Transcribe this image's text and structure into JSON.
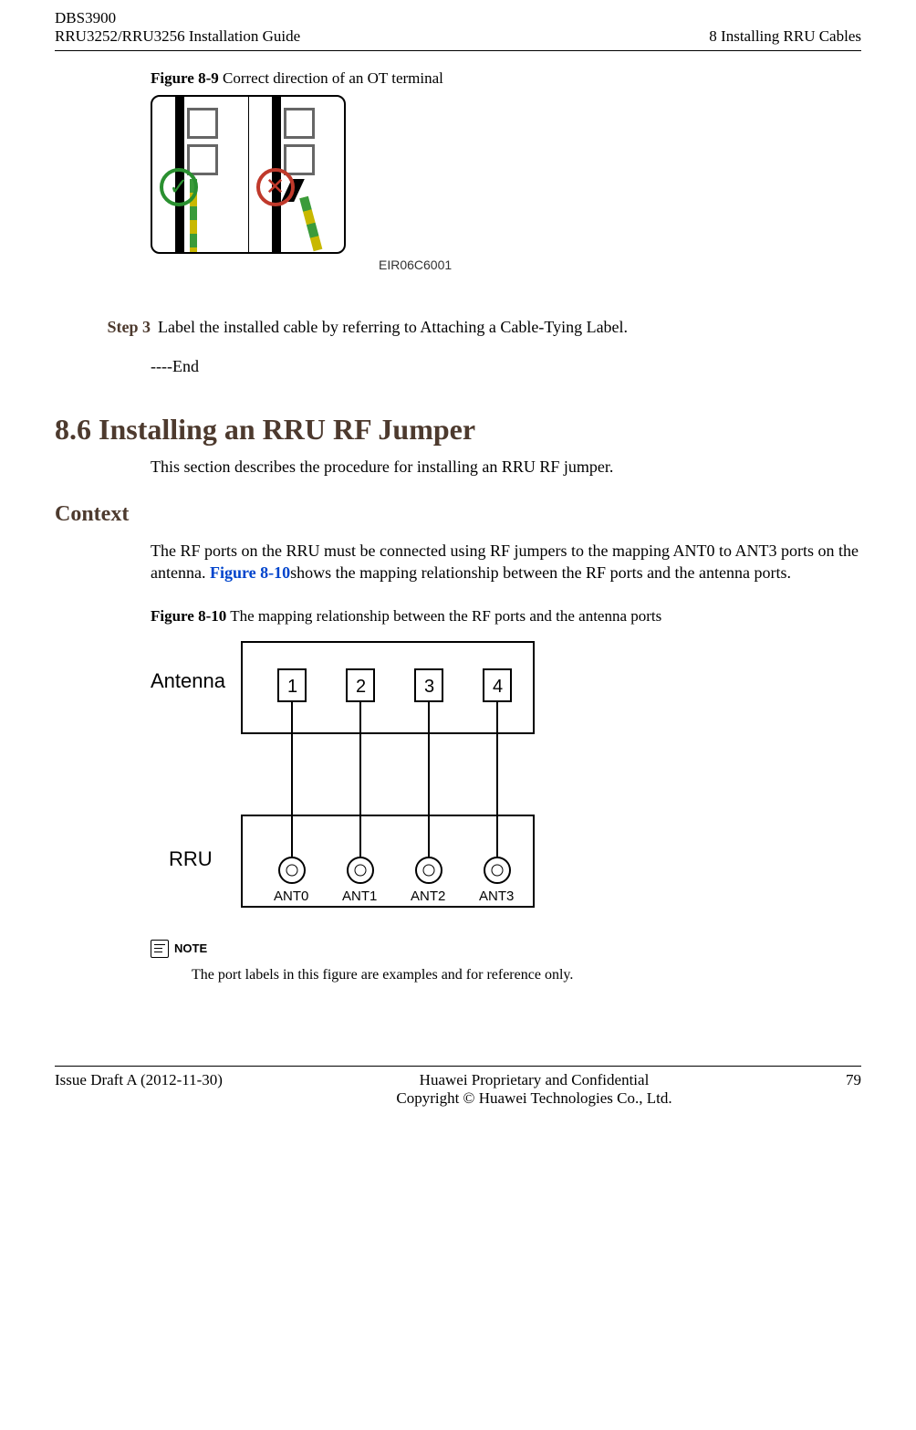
{
  "header": {
    "product": "DBS3900",
    "guide": "RRU3252/RRU3256 Installation Guide",
    "chapter": "8 Installing RRU Cables"
  },
  "figure_8_9": {
    "label": "Figure 8-9",
    "caption": " Correct direction of an OT terminal",
    "id": "EIR06C6001"
  },
  "step3": {
    "label": "Step 3",
    "text": "Label the installed cable by referring to Attaching a Cable-Tying Label."
  },
  "end_marker": "----End",
  "section_8_6": {
    "title": "8.6 Installing an RRU RF Jumper",
    "desc": "This section describes the procedure for installing an RRU RF jumper."
  },
  "context": {
    "heading": "Context",
    "text_pre": "The RF ports on the RRU must be connected using RF jumpers to the mapping ANT0 to ANT3 ports on the antenna. ",
    "link": "Figure 8-10",
    "text_post": "shows the mapping relationship between the RF ports and the antenna ports."
  },
  "figure_8_10": {
    "label": "Figure 8-10",
    "caption": " The mapping relationship between the RF ports and the antenna ports",
    "antenna_label": "Antenna",
    "rru_label": "RRU",
    "antenna_ports": [
      "1",
      "2",
      "3",
      "4"
    ],
    "rru_ports": [
      "ANT0",
      "ANT1",
      "ANT2",
      "ANT3"
    ]
  },
  "note": {
    "label": "NOTE",
    "text": "The port labels in this figure are examples and for reference only."
  },
  "footer": {
    "issue": "Issue Draft A (2012-11-30)",
    "proprietary": "Huawei Proprietary and Confidential",
    "copyright": "Copyright © Huawei Technologies Co., Ltd.",
    "page": "79"
  }
}
